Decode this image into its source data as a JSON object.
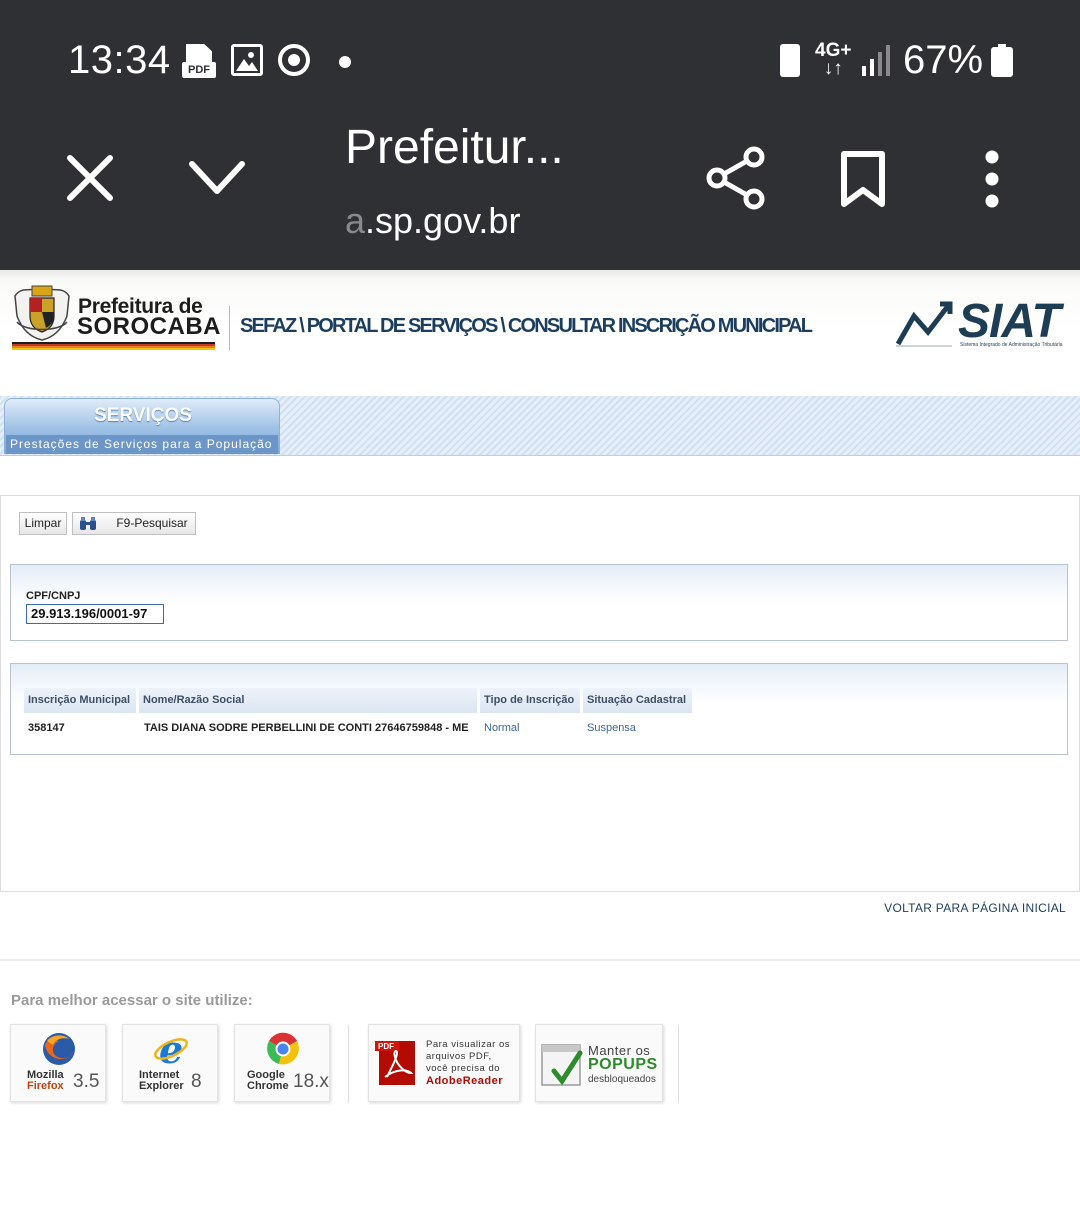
{
  "status_bar": {
    "time": "13:34",
    "pdf_label": "PDF",
    "network": "4G+",
    "battery": "67%"
  },
  "custom_tab": {
    "title": "Prefeitur...",
    "url_faded": "a",
    "url": ".sp.gov.br"
  },
  "header": {
    "brand_line1": "Prefeitura de",
    "brand_line2": "SOROCABA",
    "breadcrumb": "SEFAZ \\ PORTAL DE SERVIÇOS \\ CONSULTAR INSCRIÇÃO MUNICIPAL",
    "siat": "SIAT",
    "siat_sub": "Sistema Integrado de Administração Tributária"
  },
  "services": {
    "title": "SERVIÇOS",
    "subtitle": "Prestações de Serviços para a População"
  },
  "toolbar": {
    "clear_label": "Limpar",
    "search_label": "F9-Pesquisar"
  },
  "form": {
    "cpf_label": "CPF/CNPJ",
    "cpf_value": "29.913.196/0001-97"
  },
  "results": {
    "headers": [
      "Inscrição Municipal",
      "Nome/Razão Social",
      "Tipo de Inscrição",
      "Situação Cadastral"
    ],
    "rows": [
      [
        "358147",
        "TAIS DIANA SODRE PERBELLINI DE CONTI 27646759848 - ME",
        "Normal",
        "Suspensa"
      ]
    ]
  },
  "back_link": "VOLTAR PARA PÁGINA INICIAL",
  "footer": {
    "label": "Para melhor acessar o site utilize:",
    "firefox": {
      "line1": "Mozilla",
      "line2": "Firefox",
      "version": "3.5"
    },
    "ie": {
      "line1": "Internet",
      "line2": "Explorer",
      "version": "8"
    },
    "chrome": {
      "line1": "Google",
      "line2": "Chrome",
      "version": "18.x"
    },
    "pdf": {
      "badge": "PDF",
      "line1": "Para visualizar os",
      "line2": "arquivos PDF,",
      "line3": "você precisa do",
      "line4": "AdobeReader"
    },
    "popups": {
      "line1": "Manter os",
      "line2": "POPUPS",
      "line3": "desbloqueados"
    }
  },
  "colors": {
    "topbar": "#2f3033",
    "brand_navy": "#1c3e5e",
    "link_blue": "#3c6797",
    "services_blue": "#6d96c8"
  }
}
